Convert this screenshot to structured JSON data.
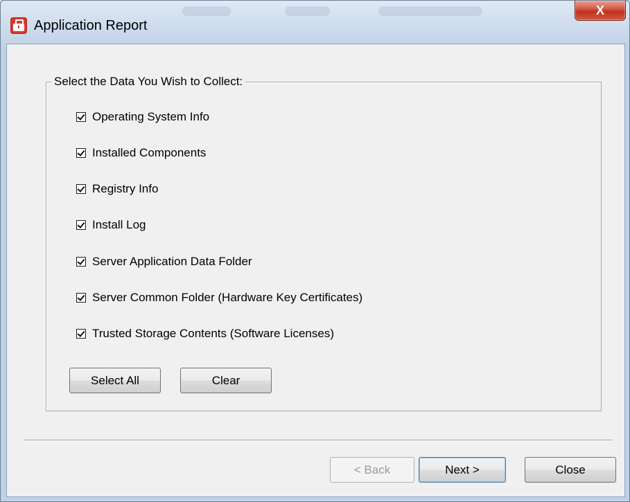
{
  "window": {
    "title": "Application Report",
    "close_glyph": "X"
  },
  "group": {
    "legend": "Select the Data You Wish to Collect:"
  },
  "options": [
    {
      "label": "Operating System Info",
      "checked": true
    },
    {
      "label": "Installed Components",
      "checked": true
    },
    {
      "label": "Registry Info",
      "checked": true
    },
    {
      "label": "Install Log",
      "checked": true
    },
    {
      "label": "Server Application Data Folder",
      "checked": true
    },
    {
      "label": "Server Common Folder (Hardware Key Certificates)",
      "checked": true
    },
    {
      "label": "Trusted Storage Contents (Software Licenses)",
      "checked": true
    }
  ],
  "buttons": {
    "select_all": "Select All",
    "clear": "Clear",
    "back": "< Back",
    "next": "Next >",
    "close": "Close"
  },
  "icons": {
    "app": "toolbox-icon",
    "checkbox": "checkmark-icon"
  },
  "colors": {
    "app_icon": "#d93a2e",
    "close_button": "#c1311d"
  }
}
